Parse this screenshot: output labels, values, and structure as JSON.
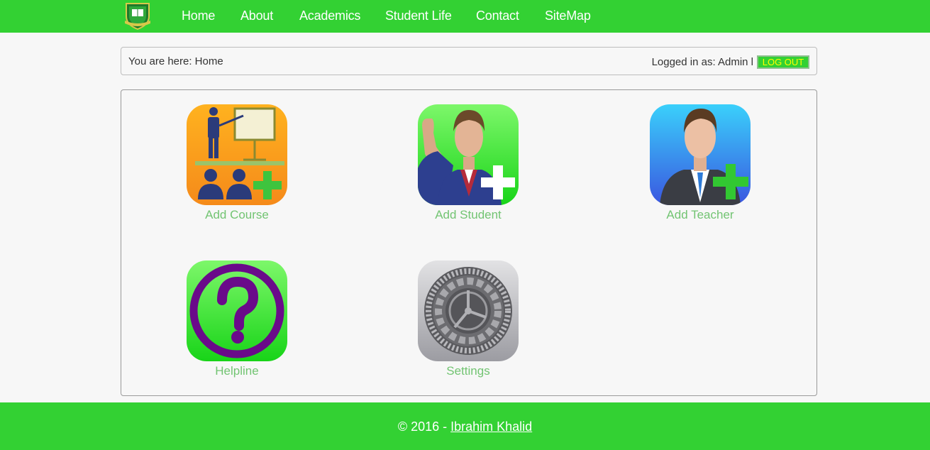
{
  "nav": {
    "links": [
      "Home",
      "About",
      "Academics",
      "Student Life",
      "Contact",
      "SiteMap"
    ]
  },
  "breadcrumb": {
    "text": "You are here: Home",
    "login_text": "Logged in as: Admin l",
    "logout_label": "LOG OUT"
  },
  "tiles": [
    {
      "label": "Add Course",
      "icon": "add-course-icon"
    },
    {
      "label": "Add Student",
      "icon": "add-student-icon"
    },
    {
      "label": "Add Teacher",
      "icon": "add-teacher-icon"
    },
    {
      "label": "Helpline",
      "icon": "helpline-icon"
    },
    {
      "label": "Settings",
      "icon": "settings-icon"
    }
  ],
  "footer": {
    "prefix": "© 2016 - ",
    "author": "Ibrahim Khalid"
  },
  "colors": {
    "brand_green": "#33d133",
    "label_green": "#72c472",
    "logout_text": "#ffff00"
  }
}
